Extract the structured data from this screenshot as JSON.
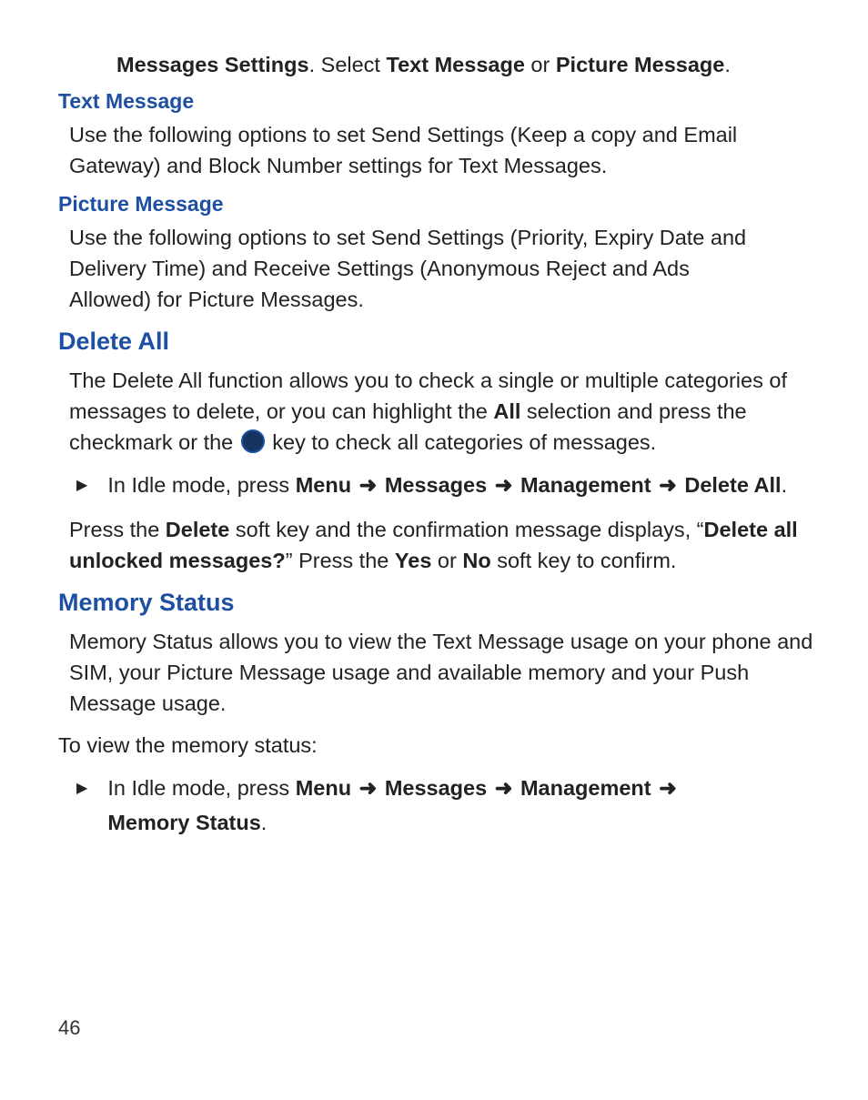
{
  "top": {
    "messages_settings": "Messages Settings",
    "period": ". Select ",
    "text_message": "Text Message",
    "or": " or ",
    "picture_message": "Picture Message",
    "end": "."
  },
  "text_msg": {
    "heading": "Text Message",
    "body": "Use the following options to set Send Settings (Keep a copy and Email Gateway) and Block Number settings for Text Messages."
  },
  "picture_msg": {
    "heading": "Picture Message",
    "body": "Use the following options to set Send Settings (Priority, Expiry Date and Delivery Time) and Receive Settings (Anonymous Reject and Ads Allowed) for Picture Messages."
  },
  "delete_all": {
    "heading": "Delete All",
    "p1_a": "The Delete All function allows you to check a single or multiple categories of messages to delete, or you can highlight the ",
    "all": "All",
    "p1_b": " selection and press the checkmark or the ",
    "p1_c": " key to check all categories of messages.",
    "step_prefix": "In Idle mode, press ",
    "menu": "Menu",
    "messages": "Messages",
    "management": "Management",
    "delete_all_b": "Delete All",
    "period": ".",
    "p2_a": "Press the ",
    "delete": "Delete",
    "p2_b": " soft key and the confirmation message displays, “",
    "confirm": "Delete all unlocked messages?",
    "p2_c": "” Press the ",
    "yes": "Yes",
    "or": " or ",
    "no": "No",
    "p2_d": " soft key to confirm."
  },
  "memory_status": {
    "heading": "Memory Status",
    "p1": "Memory Status allows you to view the Text Message usage on your phone and SIM, your Picture Message usage and available memory and your Push Message usage.",
    "p2": "To view the memory status:",
    "step_prefix": "In Idle mode, press ",
    "menu": "Menu",
    "messages": "Messages",
    "management": "Management",
    "memory_status_b": "Memory Status",
    "period": "."
  },
  "arrow": "➜",
  "bullet": "▶",
  "page_number": "46"
}
